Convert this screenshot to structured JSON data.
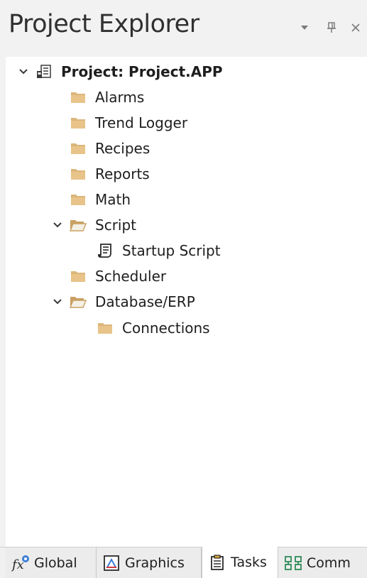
{
  "panel": {
    "title": "Project Explorer",
    "dropdown_icon": "dropdown-arrow-icon",
    "pin_icon": "pin-icon",
    "close_icon": "close-icon"
  },
  "tree": {
    "root": {
      "label": "Project: Project.APP",
      "icon": "project-icon",
      "expanded": true
    },
    "items": [
      {
        "label": "Alarms",
        "icon": "folder-icon"
      },
      {
        "label": "Trend Logger",
        "icon": "folder-icon"
      },
      {
        "label": "Recipes",
        "icon": "folder-icon"
      },
      {
        "label": "Reports",
        "icon": "folder-icon"
      },
      {
        "label": "Math",
        "icon": "folder-icon"
      },
      {
        "label": "Script",
        "icon": "folder-open-icon",
        "expanded": true
      },
      {
        "label": "Startup Script",
        "icon": "script-icon"
      },
      {
        "label": "Scheduler",
        "icon": "folder-icon"
      },
      {
        "label": "Database/ERP",
        "icon": "folder-open-icon",
        "expanded": true
      },
      {
        "label": "Connections",
        "icon": "folder-icon"
      }
    ]
  },
  "tabs": [
    {
      "label": "Global",
      "icon": "fx-icon",
      "active": false
    },
    {
      "label": "Graphics",
      "icon": "graphics-icon",
      "active": false
    },
    {
      "label": "Tasks",
      "icon": "tasks-icon",
      "active": true
    },
    {
      "label": "Comm",
      "icon": "comm-icon",
      "active": false
    }
  ],
  "colors": {
    "folder": "#dcb67a",
    "folder_dark": "#c9a063",
    "text": "#1e1e1e",
    "title_text": "#303030",
    "panel_bg": "#f2f2f2",
    "tab_bg": "#ececec"
  }
}
